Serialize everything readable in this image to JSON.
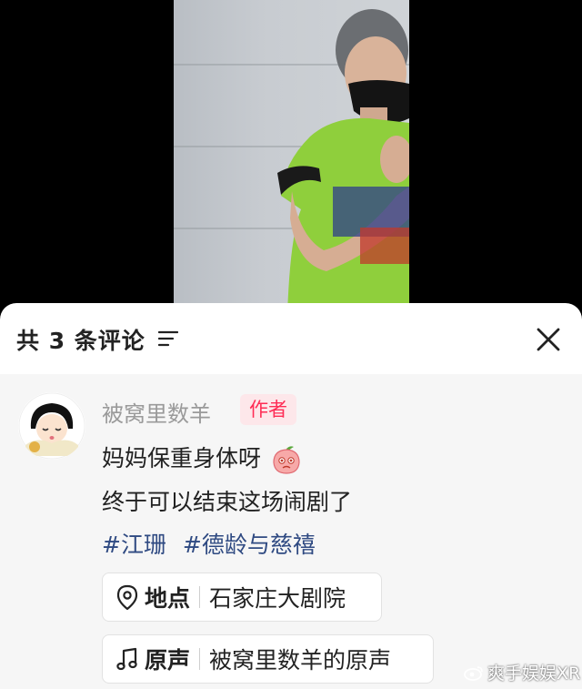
{
  "comments_panel": {
    "title": "共 3 条评论",
    "comment": {
      "username": "被窝里数羊",
      "badge": "作者",
      "line1": "妈妈保重身体呀",
      "line2": "终于可以结束这场闹剧了",
      "hashtags": [
        "#江珊",
        "#德龄与慈禧"
      ],
      "location_label": "地点",
      "location_value": "石家庄大剧院",
      "sound_label": "原声",
      "sound_value": "被窝里数羊的原声"
    }
  },
  "watermark": "爽手娱娱XR",
  "colors": {
    "accent": "#fe2c55",
    "hashtag": "#2f4a82",
    "shirt": "#8fcf3c"
  }
}
